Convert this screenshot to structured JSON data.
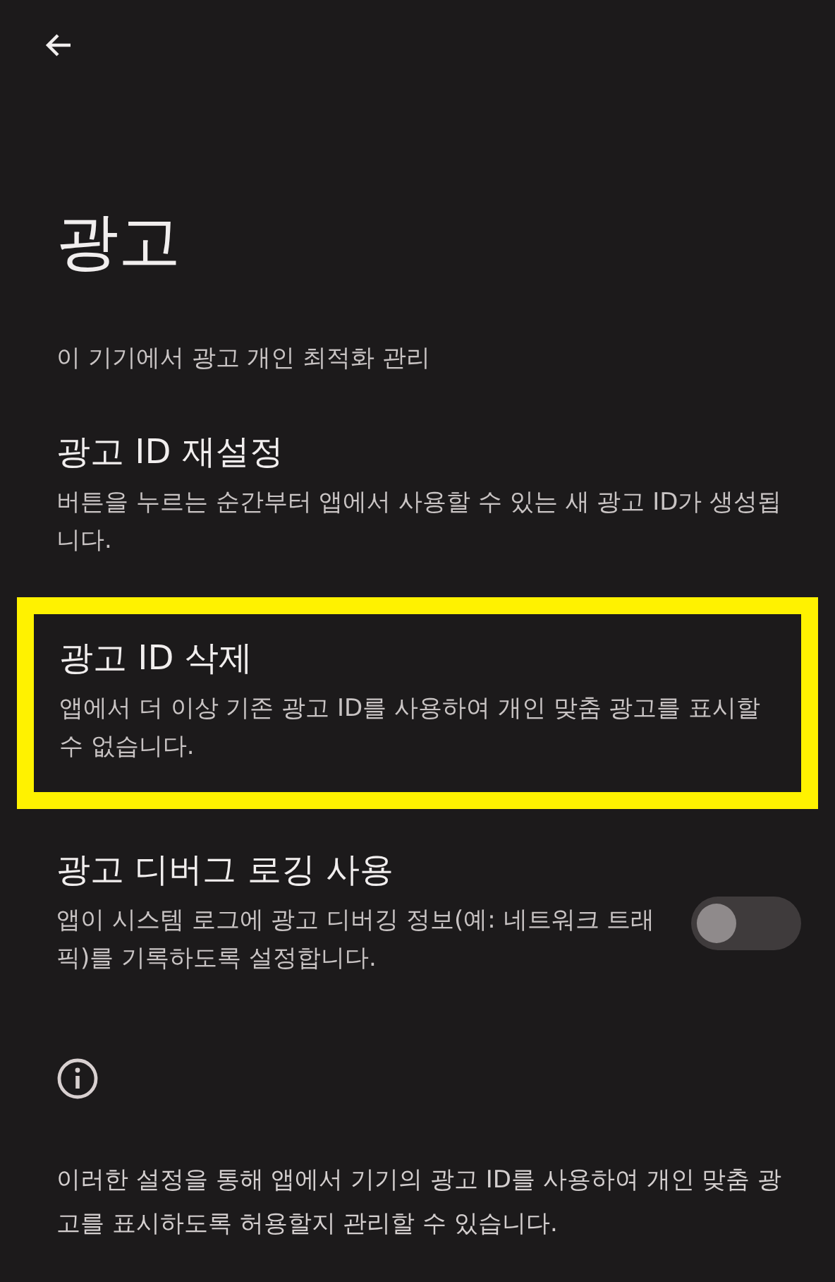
{
  "title": "광고",
  "subtitle": "이 기기에서 광고 개인 최적화 관리",
  "items": [
    {
      "kind": "action",
      "title": "광고 ID 재설정",
      "description": "버튼을 누르는 순간부터 앱에서 사용할 수 있는 새 광고 ID가 생성됩니다.",
      "highlighted": false
    },
    {
      "kind": "action",
      "title": "광고 ID 삭제",
      "description": "앱에서 더 이상 기존 광고 ID를 사용하여 개인 맞춤 광고를 표시할 수 없습니다.",
      "highlighted": true
    },
    {
      "kind": "toggle",
      "title": "광고 디버그 로깅 사용",
      "description": "앱이 시스템 로그에 광고 디버깅 정보(예: 네트워크 트래픽)를 기록하도록 설정합니다.",
      "highlighted": false,
      "on": false
    }
  ],
  "footer": "이러한 설정을 통해 앱에서 기기의 광고 ID를 사용하여 개인 맞춤 광고를 표시하도록 허용할지 관리할 수 있습니다."
}
